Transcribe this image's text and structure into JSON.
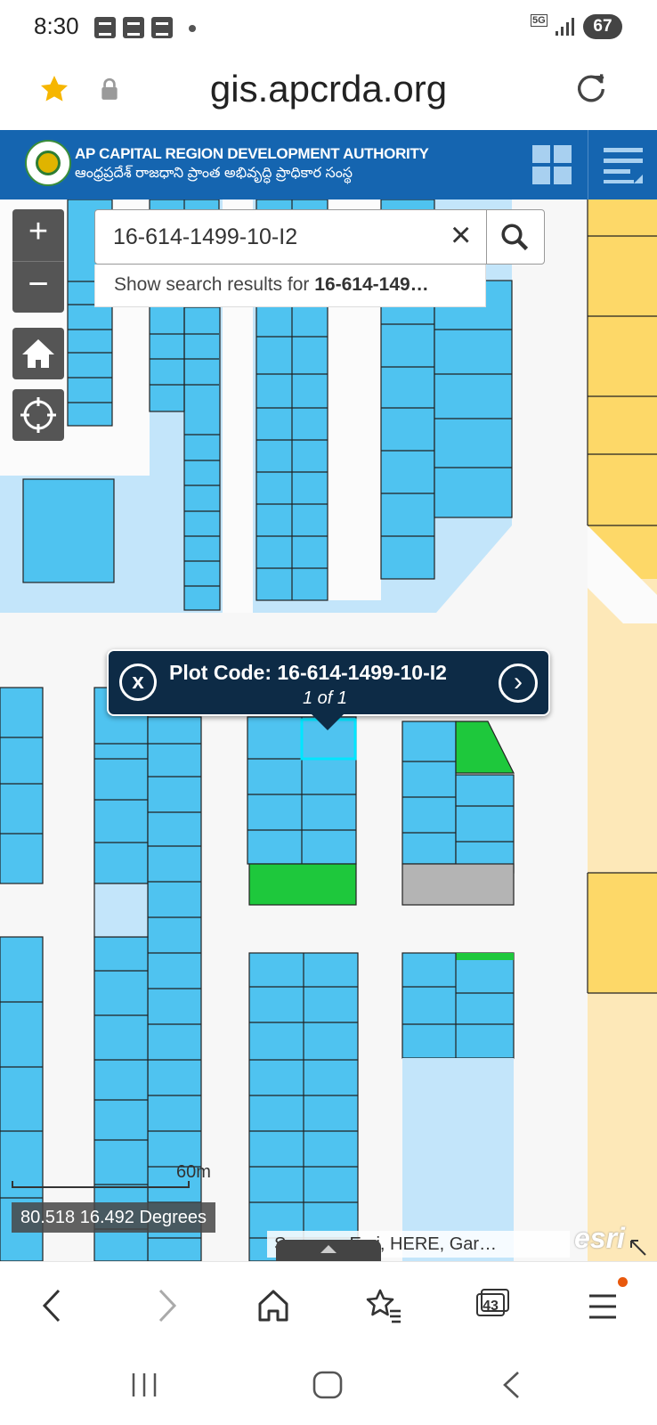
{
  "status_bar": {
    "time": "8:30",
    "network": "5G",
    "battery": "67"
  },
  "browser": {
    "url": "gis.apcrda.org",
    "tab_count": "43"
  },
  "header": {
    "org_title": "AP CAPITAL REGION DEVELOPMENT AUTHORITY",
    "org_subtitle": "ఆంధ్రప్రదేశ్ రాజధాని ప్రాంత అభివృద్ధి ప్రాధికార సంస్థ"
  },
  "map_controls": {
    "zoom_in": "+",
    "zoom_out": "−"
  },
  "search": {
    "value": "16-614-1499-10-I2",
    "suggestion_prefix": "Show search results for ",
    "suggestion_term": "16-614-149…"
  },
  "popup": {
    "title": "Plot Code: 16-614-1499-10-I2",
    "count": "1 of 1"
  },
  "map_footer": {
    "scale_label": "60m",
    "coordinates": "80.518 16.492 Degrees",
    "attribution": "Sources: Esri, HERE, Gar…",
    "logo": "esri"
  },
  "colors": {
    "header_bg": "#1565b0",
    "plot_blue": "#4fc3f0",
    "plot_green": "#1ec83c",
    "plot_gray": "#b4b4b4",
    "light_blue_area": "#c3e5fa",
    "yellow_zone": "#fdd868",
    "light_yellow_zone": "#fde8b8",
    "popup_bg": "#0d2b46",
    "star": "#f6b600"
  }
}
